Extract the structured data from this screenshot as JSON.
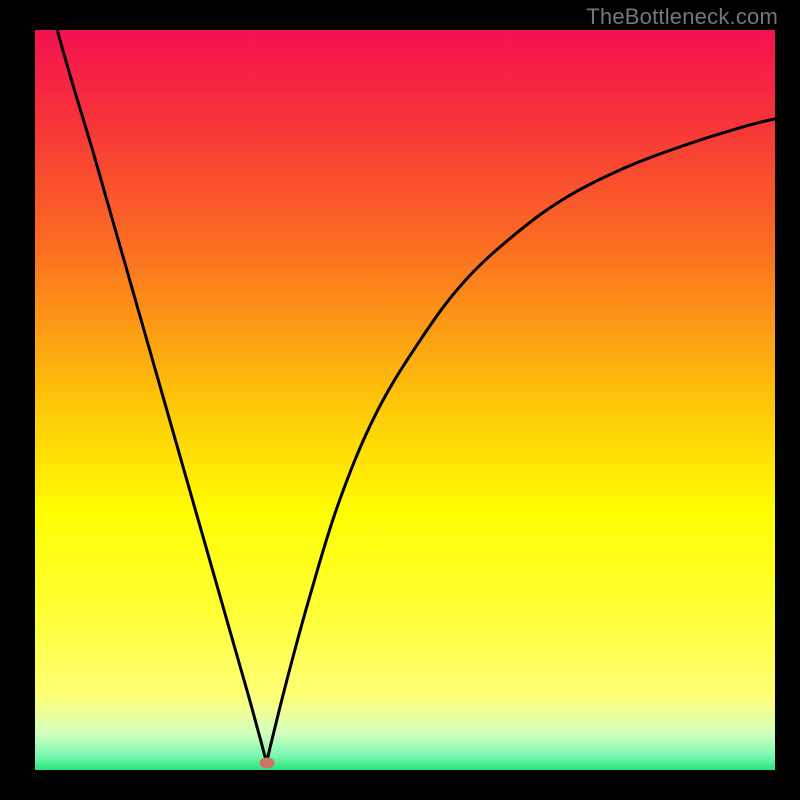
{
  "watermark": "TheBottleneck.com",
  "chart_data": {
    "type": "line",
    "title": "",
    "xlabel": "",
    "ylabel": "",
    "xlim": [
      0,
      100
    ],
    "ylim": [
      0,
      100
    ],
    "gradient_stops": [
      {
        "pct": 0,
        "color": "#f4114f"
      },
      {
        "pct": 12,
        "color": "#f7333a"
      },
      {
        "pct": 30,
        "color": "#fb7020"
      },
      {
        "pct": 50,
        "color": "#fec409"
      },
      {
        "pct": 65,
        "color": "#fffd01"
      },
      {
        "pct": 78,
        "color": "#ffff33"
      },
      {
        "pct": 90,
        "color": "#ffff77"
      },
      {
        "pct": 95,
        "color": "#d4ffbe"
      },
      {
        "pct": 98,
        "color": "#7cf8b2"
      },
      {
        "pct": 100,
        "color": "#2be47b"
      }
    ],
    "series": [
      {
        "name": "left-branch",
        "x": [
          3,
          5,
          8,
          12,
          16,
          20,
          24,
          27,
          29,
          30.5,
          31.3
        ],
        "y": [
          100,
          93,
          83,
          69,
          55,
          41,
          27,
          16.5,
          9.5,
          4,
          1
        ]
      },
      {
        "name": "right-branch",
        "x": [
          31.3,
          32,
          34,
          37,
          41,
          46,
          52,
          58,
          65,
          72,
          80,
          88,
          96,
          100
        ],
        "y": [
          1,
          4,
          12,
          23,
          36,
          48,
          58,
          66,
          72.5,
          77.5,
          81.5,
          84.5,
          87,
          88
        ]
      }
    ],
    "marker": {
      "x": 31.3,
      "y": 1,
      "color": "#cb7561"
    },
    "curve_stroke": "#000000",
    "curve_width": 3
  }
}
